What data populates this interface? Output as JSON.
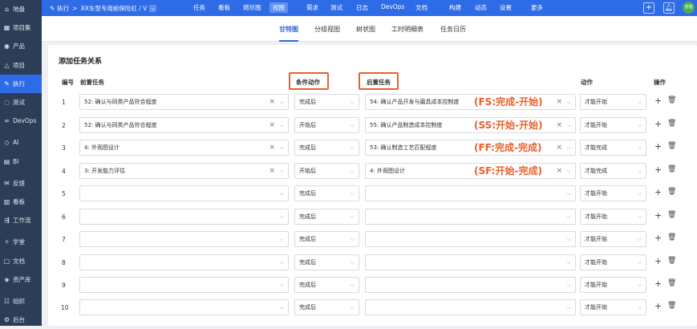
{
  "sidebar": {
    "items": [
      {
        "label": "地盘",
        "icon": "home-icon"
      },
      {
        "label": "项目集",
        "icon": "grid-icon"
      },
      {
        "label": "产品",
        "icon": "location-icon"
      },
      {
        "label": "项目",
        "icon": "project-icon"
      },
      {
        "label": "执行",
        "icon": "execute-icon",
        "active": true
      },
      {
        "label": "测试",
        "icon": "test-icon"
      },
      {
        "label": "DevOps",
        "icon": "devops-icon"
      },
      {
        "label": "AI",
        "icon": "ai-icon"
      },
      {
        "label": "BI",
        "icon": "bi-icon"
      },
      {
        "label": "反馈",
        "icon": "feedback-icon"
      },
      {
        "label": "看板",
        "icon": "kanban-icon"
      },
      {
        "label": "工作流",
        "icon": "workflow-icon"
      },
      {
        "label": "学堂",
        "icon": "school-icon"
      },
      {
        "label": "文档",
        "icon": "doc-icon"
      },
      {
        "label": "资产库",
        "icon": "asset-icon"
      },
      {
        "label": "组织",
        "icon": "org-icon"
      },
      {
        "label": "后台",
        "icon": "admin-icon"
      }
    ]
  },
  "topbar": {
    "breadcrumb_root": "执行",
    "breadcrumb_sep": ">",
    "execution_name": "XX车型专用前保险杠 / V",
    "nav": [
      {
        "label": "任务"
      },
      {
        "label": "看板"
      },
      {
        "label": "燃尽图"
      },
      {
        "label": "视图",
        "active": true
      },
      {
        "label": "需求"
      },
      {
        "label": "测试"
      },
      {
        "label": "日志"
      },
      {
        "label": "DevOps"
      },
      {
        "label": "文档"
      },
      {
        "label": "构建"
      },
      {
        "label": "动态"
      },
      {
        "label": "设置"
      },
      {
        "label": "更多"
      }
    ],
    "add_btn": "+",
    "bell_icon": "bell-icon",
    "avatar_text": "管理"
  },
  "subtabs": [
    {
      "label": "甘特图",
      "active": true
    },
    {
      "label": "分组视图"
    },
    {
      "label": "树状图"
    },
    {
      "label": "工时明细表"
    },
    {
      "label": "任务日历"
    }
  ],
  "section_title": "添加任务关系",
  "headers": {
    "num": "编号",
    "pre_task": "前置任务",
    "condition": "条件动作",
    "post_task": "后置任务",
    "action": "动作",
    "ops": "操作"
  },
  "rows": [
    {
      "num": "1",
      "pre": "52: 确认与同类产品符合程度",
      "cond": "完成后",
      "post": "54: 确认产品开发与磨具成本控制度",
      "action": "才能开始",
      "note": "(FS:完成-开始)"
    },
    {
      "num": "2",
      "pre": "52: 确认与同类产品符合程度",
      "cond": "开始后",
      "post": "55: 确认产品制造成本控制度",
      "action": "才能开始",
      "note": "(SS:开始-开始)"
    },
    {
      "num": "3",
      "pre": "4: 外观图设计",
      "cond": "完成后",
      "post": "53: 确认制造工艺匹配程度",
      "action": "才能完成",
      "note": "(FF:完成-完成)"
    },
    {
      "num": "4",
      "pre": "3: 开发能力评估",
      "cond": "开始后",
      "post": "4: 外观图设计",
      "action": "才能完成",
      "note": "(SF:开始-完成)"
    },
    {
      "num": "5",
      "pre": "",
      "cond": "完成后",
      "post": "",
      "action": "才能开始",
      "note": ""
    },
    {
      "num": "6",
      "pre": "",
      "cond": "完成后",
      "post": "",
      "action": "才能开始",
      "note": ""
    },
    {
      "num": "7",
      "pre": "",
      "cond": "完成后",
      "post": "",
      "action": "才能开始",
      "note": ""
    },
    {
      "num": "8",
      "pre": "",
      "cond": "完成后",
      "post": "",
      "action": "才能开始",
      "note": ""
    },
    {
      "num": "9",
      "pre": "",
      "cond": "完成后",
      "post": "",
      "action": "才能开始",
      "note": ""
    },
    {
      "num": "10",
      "pre": "",
      "cond": "完成后",
      "post": "",
      "action": "才能开始",
      "note": ""
    }
  ],
  "colors": {
    "primary": "#2e6be6",
    "sidebar": "#2c3e57",
    "highlight": "#e8612c"
  }
}
